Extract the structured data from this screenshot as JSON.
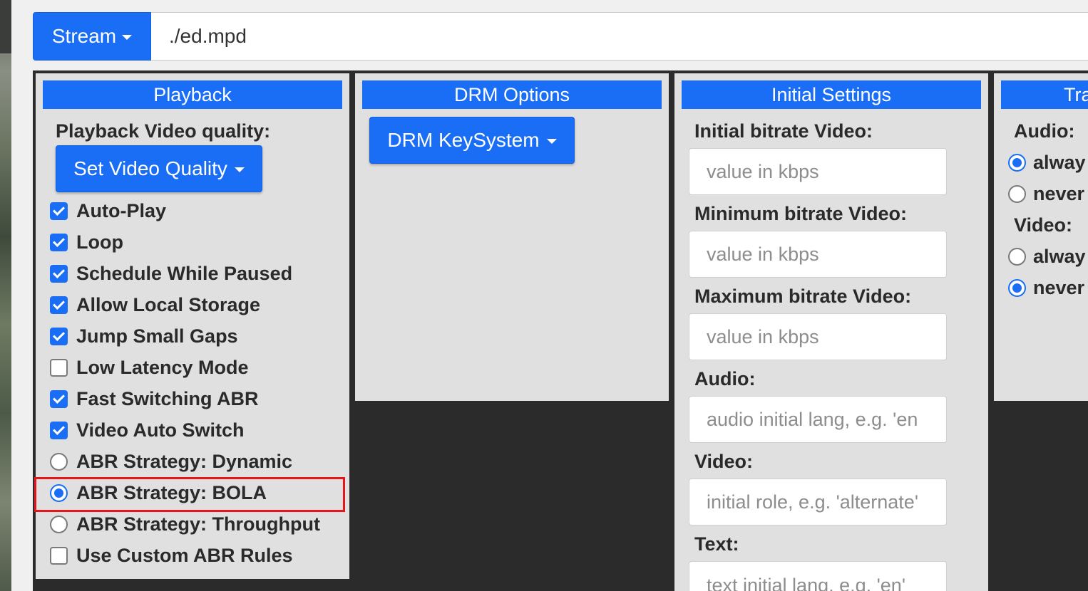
{
  "top": {
    "stream_label": "Stream",
    "url_value": "./ed.mpd"
  },
  "playback": {
    "header": "Playback",
    "quality_label": "Playback Video quality:",
    "set_quality_button": "Set Video Quality",
    "options": [
      {
        "label": "Auto-Play",
        "type": "checkbox",
        "checked": true
      },
      {
        "label": "Loop",
        "type": "checkbox",
        "checked": true
      },
      {
        "label": "Schedule While Paused",
        "type": "checkbox",
        "checked": true
      },
      {
        "label": "Allow Local Storage",
        "type": "checkbox",
        "checked": true
      },
      {
        "label": "Jump Small Gaps",
        "type": "checkbox",
        "checked": true
      },
      {
        "label": "Low Latency Mode",
        "type": "checkbox",
        "checked": false
      },
      {
        "label": "Fast Switching ABR",
        "type": "checkbox",
        "checked": true
      },
      {
        "label": "Video Auto Switch",
        "type": "checkbox",
        "checked": true
      },
      {
        "label": "ABR Strategy: Dynamic",
        "type": "radio",
        "checked": false
      },
      {
        "label": "ABR Strategy: BOLA",
        "type": "radio",
        "checked": true
      },
      {
        "label": "ABR Strategy: Throughput",
        "type": "radio",
        "checked": false
      },
      {
        "label": "Use Custom ABR Rules",
        "type": "checkbox",
        "checked": false
      }
    ]
  },
  "drm": {
    "header": "DRM Options",
    "keysystem_button": "DRM KeySystem"
  },
  "initial": {
    "header": "Initial Settings",
    "initial_bitrate_label": "Initial bitrate Video:",
    "initial_bitrate_placeholder": "value in kbps",
    "min_bitrate_label": "Minimum bitrate Video:",
    "min_bitrate_placeholder": "value in kbps",
    "max_bitrate_label": "Maximum bitrate Video:",
    "max_bitrate_placeholder": "value in kbps",
    "audio_label": "Audio:",
    "audio_placeholder": "audio initial lang, e.g. 'en",
    "video_label": "Video:",
    "video_placeholder": "initial role, e.g. 'alternate'",
    "text_label": "Text:",
    "text_placeholder": "text initial lang, e.g. 'en'"
  },
  "track": {
    "header": "Tra",
    "audio_label": "Audio:",
    "audio_always": "alway",
    "audio_never": "never",
    "video_label": "Video:",
    "video_always": "alway",
    "video_never": "never"
  },
  "colors": {
    "accent": "#1a6ef5",
    "highlight": "#e8141c",
    "panel_bg": "#e0e0e0",
    "dark_bg": "#2b2b2b"
  }
}
